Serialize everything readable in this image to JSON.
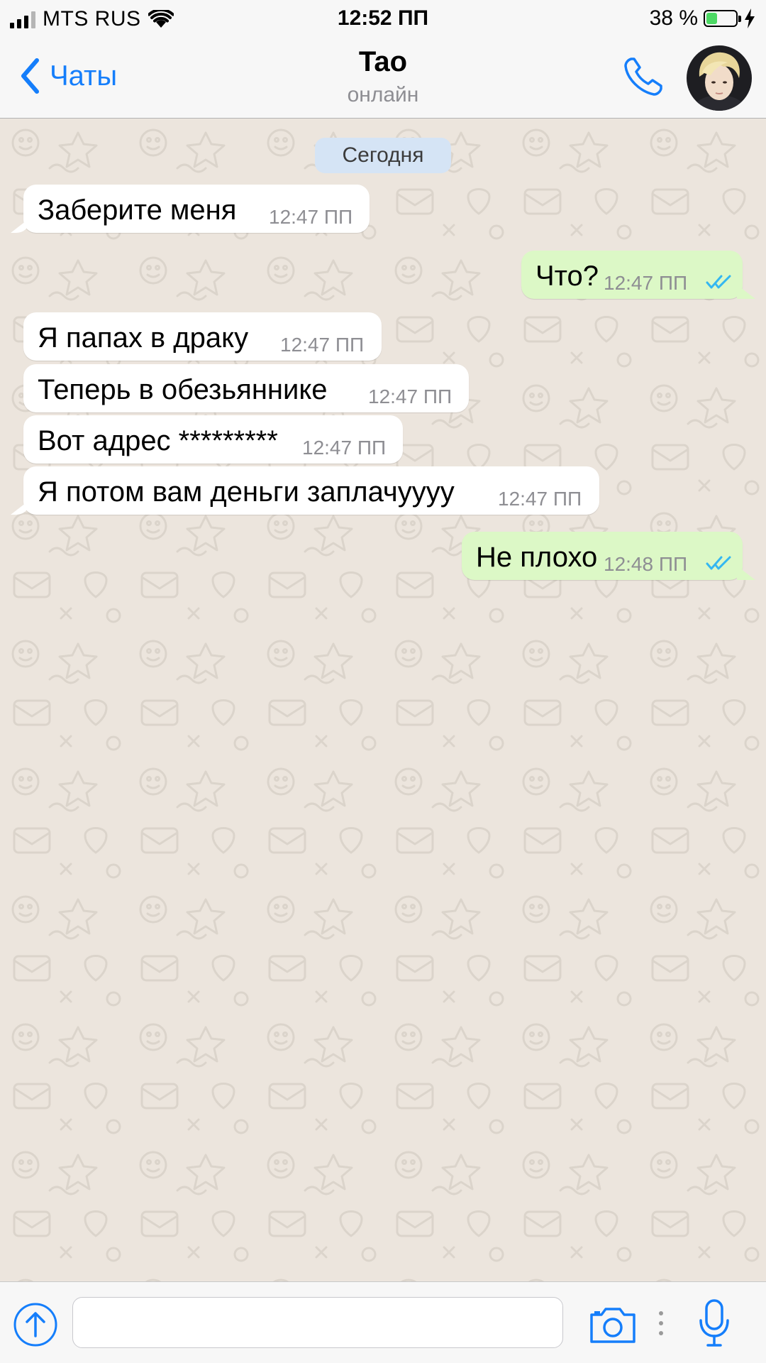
{
  "status_bar": {
    "carrier": "MTS RUS",
    "time": "12:52 ПП",
    "battery_percent": "38 %",
    "battery_level": 0.38,
    "signal_bars": 3
  },
  "header": {
    "back_label": "Чаты",
    "contact_name": "Tao",
    "contact_status": "онлайн",
    "icons": [
      "chevron-left-icon",
      "phone-icon",
      "avatar"
    ]
  },
  "chat": {
    "date_separator": "Сегодня",
    "messages": [
      {
        "direction": "in",
        "text": "Заберите меня",
        "time": "12:47 ПП"
      },
      {
        "direction": "out",
        "text": "Что?",
        "time": "12:47 ПП",
        "read": true
      },
      {
        "direction": "in",
        "text": "Я папах в драку",
        "time": "12:47 ПП"
      },
      {
        "direction": "in",
        "text": "Теперь в обезьяннике",
        "time": "12:47 ПП"
      },
      {
        "direction": "in",
        "text": "Вот адрес *********",
        "time": "12:47 ПП"
      },
      {
        "direction": "in",
        "text": "Я потом вам деньги заплачуууу",
        "time": "12:47 ПП"
      },
      {
        "direction": "out",
        "text": "Не плохо",
        "time": "12:48 ПП",
        "read": true
      }
    ]
  },
  "input_bar": {
    "placeholder": "",
    "icons": [
      "upload-icon",
      "camera-icon",
      "more-icon",
      "microphone-icon"
    ]
  },
  "colors": {
    "accent": "#157efb",
    "outgoing_bubble": "#dcf8c6",
    "incoming_bubble": "#ffffff",
    "chat_background": "#ece5dd",
    "date_chip": "#d5e4f5",
    "read_ticks": "#34b7f1"
  }
}
